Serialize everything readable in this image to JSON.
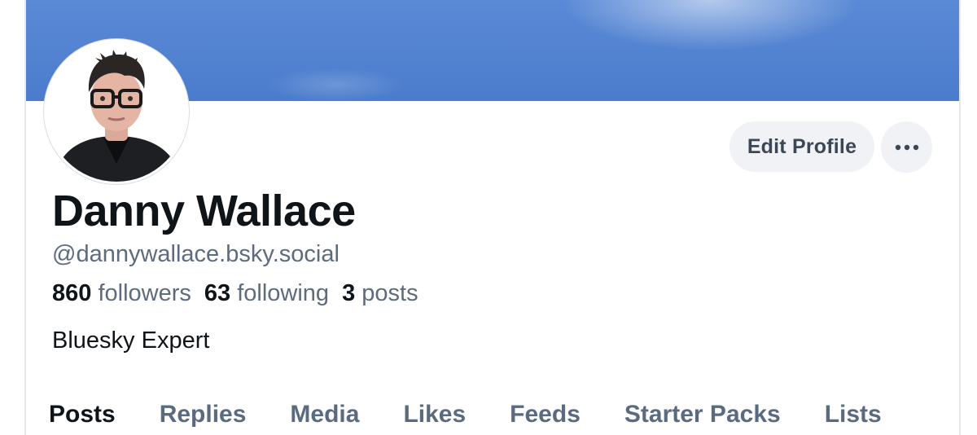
{
  "profile": {
    "display_name": "Danny Wallace",
    "handle": "@dannywallace.bsky.social",
    "bio": "Bluesky Expert",
    "stats": {
      "followers_count": "860",
      "followers_label": "followers",
      "following_count": "63",
      "following_label": "following",
      "posts_count": "3",
      "posts_label": "posts"
    }
  },
  "actions": {
    "edit_profile_label": "Edit Profile",
    "more_icon": "ellipsis-icon"
  },
  "tabs": [
    {
      "label": "Posts",
      "active": true
    },
    {
      "label": "Replies"
    },
    {
      "label": "Media"
    },
    {
      "label": "Likes"
    },
    {
      "label": "Feeds"
    },
    {
      "label": "Starter Packs"
    },
    {
      "label": "Lists"
    }
  ],
  "colors": {
    "banner": "#4b7ccc",
    "button_bg": "#f0f2f5",
    "secondary_text": "#5d6b7d",
    "primary_text": "#0f1419"
  }
}
